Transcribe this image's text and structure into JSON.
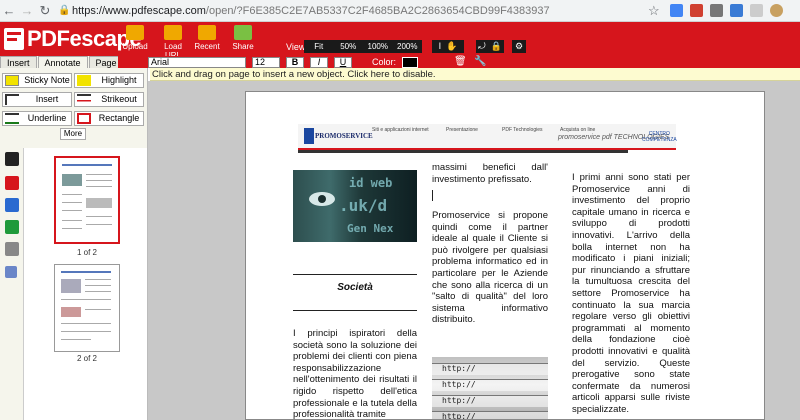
{
  "browser": {
    "back_icon": "arrow-left-icon",
    "forward_icon": "arrow-right-icon",
    "reload_icon": "reload-icon",
    "url_host": "https://www.pdfescape.com",
    "url_path": "/open/?F6E385C2E7AB5337C2F4685BA2C2863654CBD99F4383937"
  },
  "app": {
    "logo_text": "PDFescape",
    "toolbar": [
      {
        "label": "Upload",
        "color": "#f0a800"
      },
      {
        "label": "Load URL",
        "color": "#f0a800"
      },
      {
        "label": "Recent",
        "color": "#f0a800"
      },
      {
        "label": "Share",
        "color": "#7ac043"
      }
    ],
    "view_label": "View:",
    "zoom_options": [
      "Fit",
      "50%",
      "100%",
      "200%"
    ],
    "accent_color": "#d6151c"
  },
  "left_panel": {
    "tabs": [
      "Insert",
      "Annotate",
      "Page"
    ],
    "active_tab": "Annotate",
    "tools": [
      {
        "label": "Sticky Note",
        "icon": "sticky-note-icon",
        "color": "#f2e300"
      },
      {
        "label": "Highlight",
        "icon": "highlight-icon",
        "color": "#f2e300"
      },
      {
        "label": "Insert",
        "icon": "text-insert-icon",
        "color": "#333333"
      },
      {
        "label": "Strikeout",
        "icon": "strikeout-icon",
        "color": "#d6151c"
      },
      {
        "label": "Underline",
        "icon": "underline-icon",
        "color": "#1a7a1a"
      },
      {
        "label": "Rectangle",
        "icon": "rectangle-icon",
        "color": "#d6151c"
      }
    ],
    "more_label": "More"
  },
  "format_bar": {
    "font": "Arial",
    "size": "12",
    "bold": "B",
    "italic": "I",
    "underline": "U",
    "color_label": "Color:",
    "color_value": "#000000"
  },
  "hint": "Click and drag on page to insert a new object. Click here to disable.",
  "thumbnails": [
    {
      "label": "1 of 2"
    },
    {
      "label": "2 of 2"
    }
  ],
  "document": {
    "banner_nav": [
      "Siti e applicazioni internet",
      "Presentazione",
      "PDF Technologies",
      "Acquista on line"
    ],
    "logo_text": "PROMOSERVICE",
    "tagline": "promoservice pdf TECHNOLOGIES",
    "centro": "CENTRO COMPETENZA",
    "photo_text": [
      "id web",
      ".uk/d",
      "Gen Nex"
    ],
    "photo2_rows": [
      "http://",
      "http://",
      "http://",
      "http://",
      "http://"
    ],
    "heading": "Società",
    "col1": "I principi ispiratori della società sono la soluzione dei problemi dei clienti con piena responsabilizzazione nell'ottenimento dei risultati il rigido rispetto dell'etica professionale e la tutela della professionalità tramite",
    "col2_top": "massimi benefici dall' investimento prefissato.",
    "col2_body": "Promoservice si propone quindi come il partner ideale al quale il Cliente si può rivolgere per qualsiasi problema informatico ed in particolare per le Aziende che sono alla ricerca di un \"salto di qualità\" del loro sistema informativo distribuito.",
    "col3": "I primi anni sono stati per Promoservice anni di investimento del proprio capitale umano in ricerca e sviluppo di prodotti innovativi. L'arrivo della bolla internet non ha modificato i piani iniziali; pur rinunciando a sfruttare la tumultuosa crescita del settore Promoservice ha continuato la sua marcia regolare verso gli obiettivi programmati al momento della fondazione cioè prodotti innovativi e qualità del servizio. Queste prerogative sono state confermate da numerosi articoli apparsi sulle riviste specializzate."
  }
}
